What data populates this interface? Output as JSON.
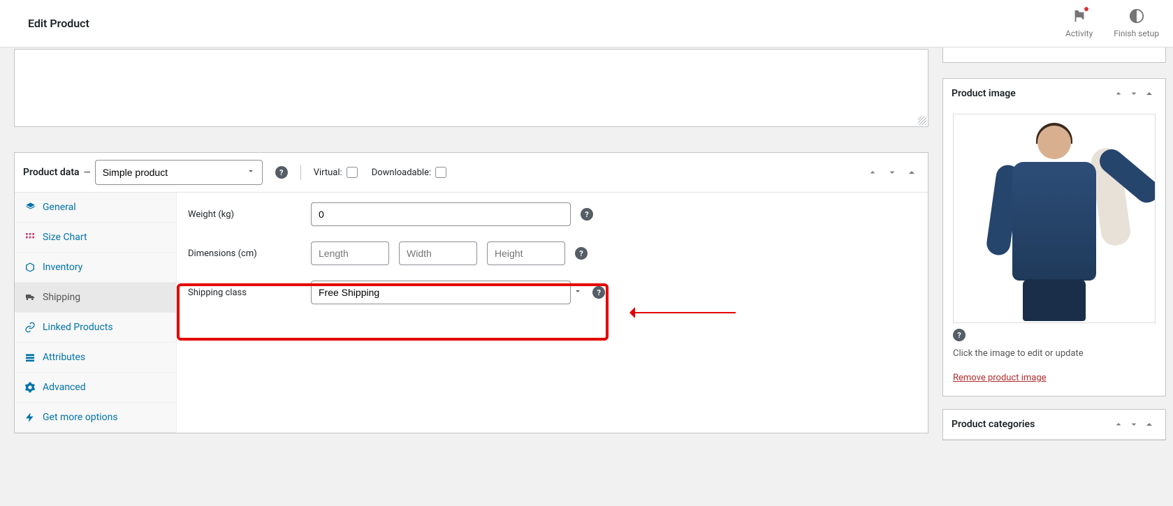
{
  "header": {
    "title": "Edit Product",
    "activity_label": "Activity",
    "finish_label": "Finish setup"
  },
  "product_data": {
    "heading": "Product data",
    "dash": "—",
    "type_select": "Simple product",
    "virtual_label": "Virtual:",
    "downloadable_label": "Downloadable:"
  },
  "tabs": {
    "general": "General",
    "size_chart": "Size Chart",
    "inventory": "Inventory",
    "shipping": "Shipping",
    "linked": "Linked Products",
    "attributes": "Attributes",
    "advanced": "Advanced",
    "more": "Get more options"
  },
  "shipping": {
    "weight_label": "Weight (kg)",
    "weight_value": "0",
    "dimensions_label": "Dimensions (cm)",
    "length_ph": "Length",
    "width_ph": "Width",
    "height_ph": "Height",
    "class_label": "Shipping class",
    "class_value": "Free Shipping"
  },
  "sidebar": {
    "product_image_title": "Product image",
    "edit_hint": "Click the image to edit or update",
    "remove_link": "Remove product image",
    "categories_title": "Product categories"
  }
}
